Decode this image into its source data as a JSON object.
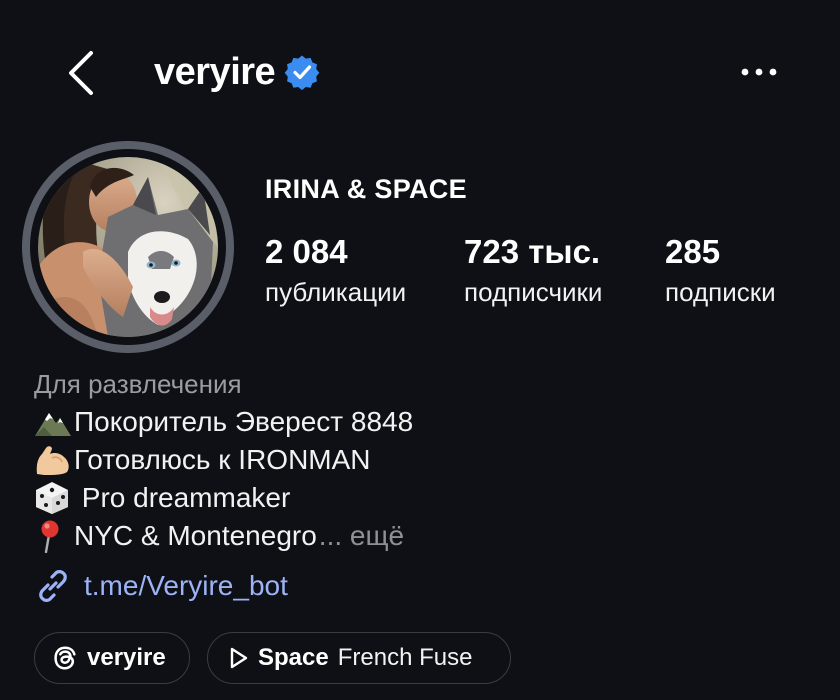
{
  "header": {
    "username": "veryire",
    "back_icon": "chevron-left-icon",
    "verified_icon": "verified-badge-icon",
    "more_icon": "more-horizontal-icon"
  },
  "profile": {
    "display_name": "IRINA & SPACE",
    "stats": [
      {
        "value": "2 084",
        "label": "публикации"
      },
      {
        "value": "723 тыс.",
        "label": "подписчики"
      },
      {
        "value": "285",
        "label": "подписки"
      }
    ]
  },
  "bio": {
    "category": "Для развлечения",
    "lines": [
      {
        "emoji": "mountain-icon",
        "text": "Покоритель Эверест 8848"
      },
      {
        "emoji": "flexed-biceps-icon",
        "text": "Готовлюсь к IRONMAN"
      },
      {
        "emoji": "dice-icon",
        "text": " Pro dreammaker"
      },
      {
        "emoji": "pushpin-icon",
        "text": "NYC & Montenegro"
      }
    ],
    "more_text": "... ещё"
  },
  "link": {
    "icon": "link-icon",
    "text": "t.me/Veryire_bot"
  },
  "pills": {
    "threads": {
      "icon": "threads-icon",
      "label": "veryire"
    },
    "music": {
      "icon": "play-icon",
      "title": "Space",
      "artist": "French Fuse"
    }
  },
  "colors": {
    "background": "#0f1015",
    "text": "#f5f5f5",
    "muted": "#9a9ca3",
    "link": "#9cb3f5",
    "verified": "#3b8cf0",
    "border": "#3a3c44"
  }
}
